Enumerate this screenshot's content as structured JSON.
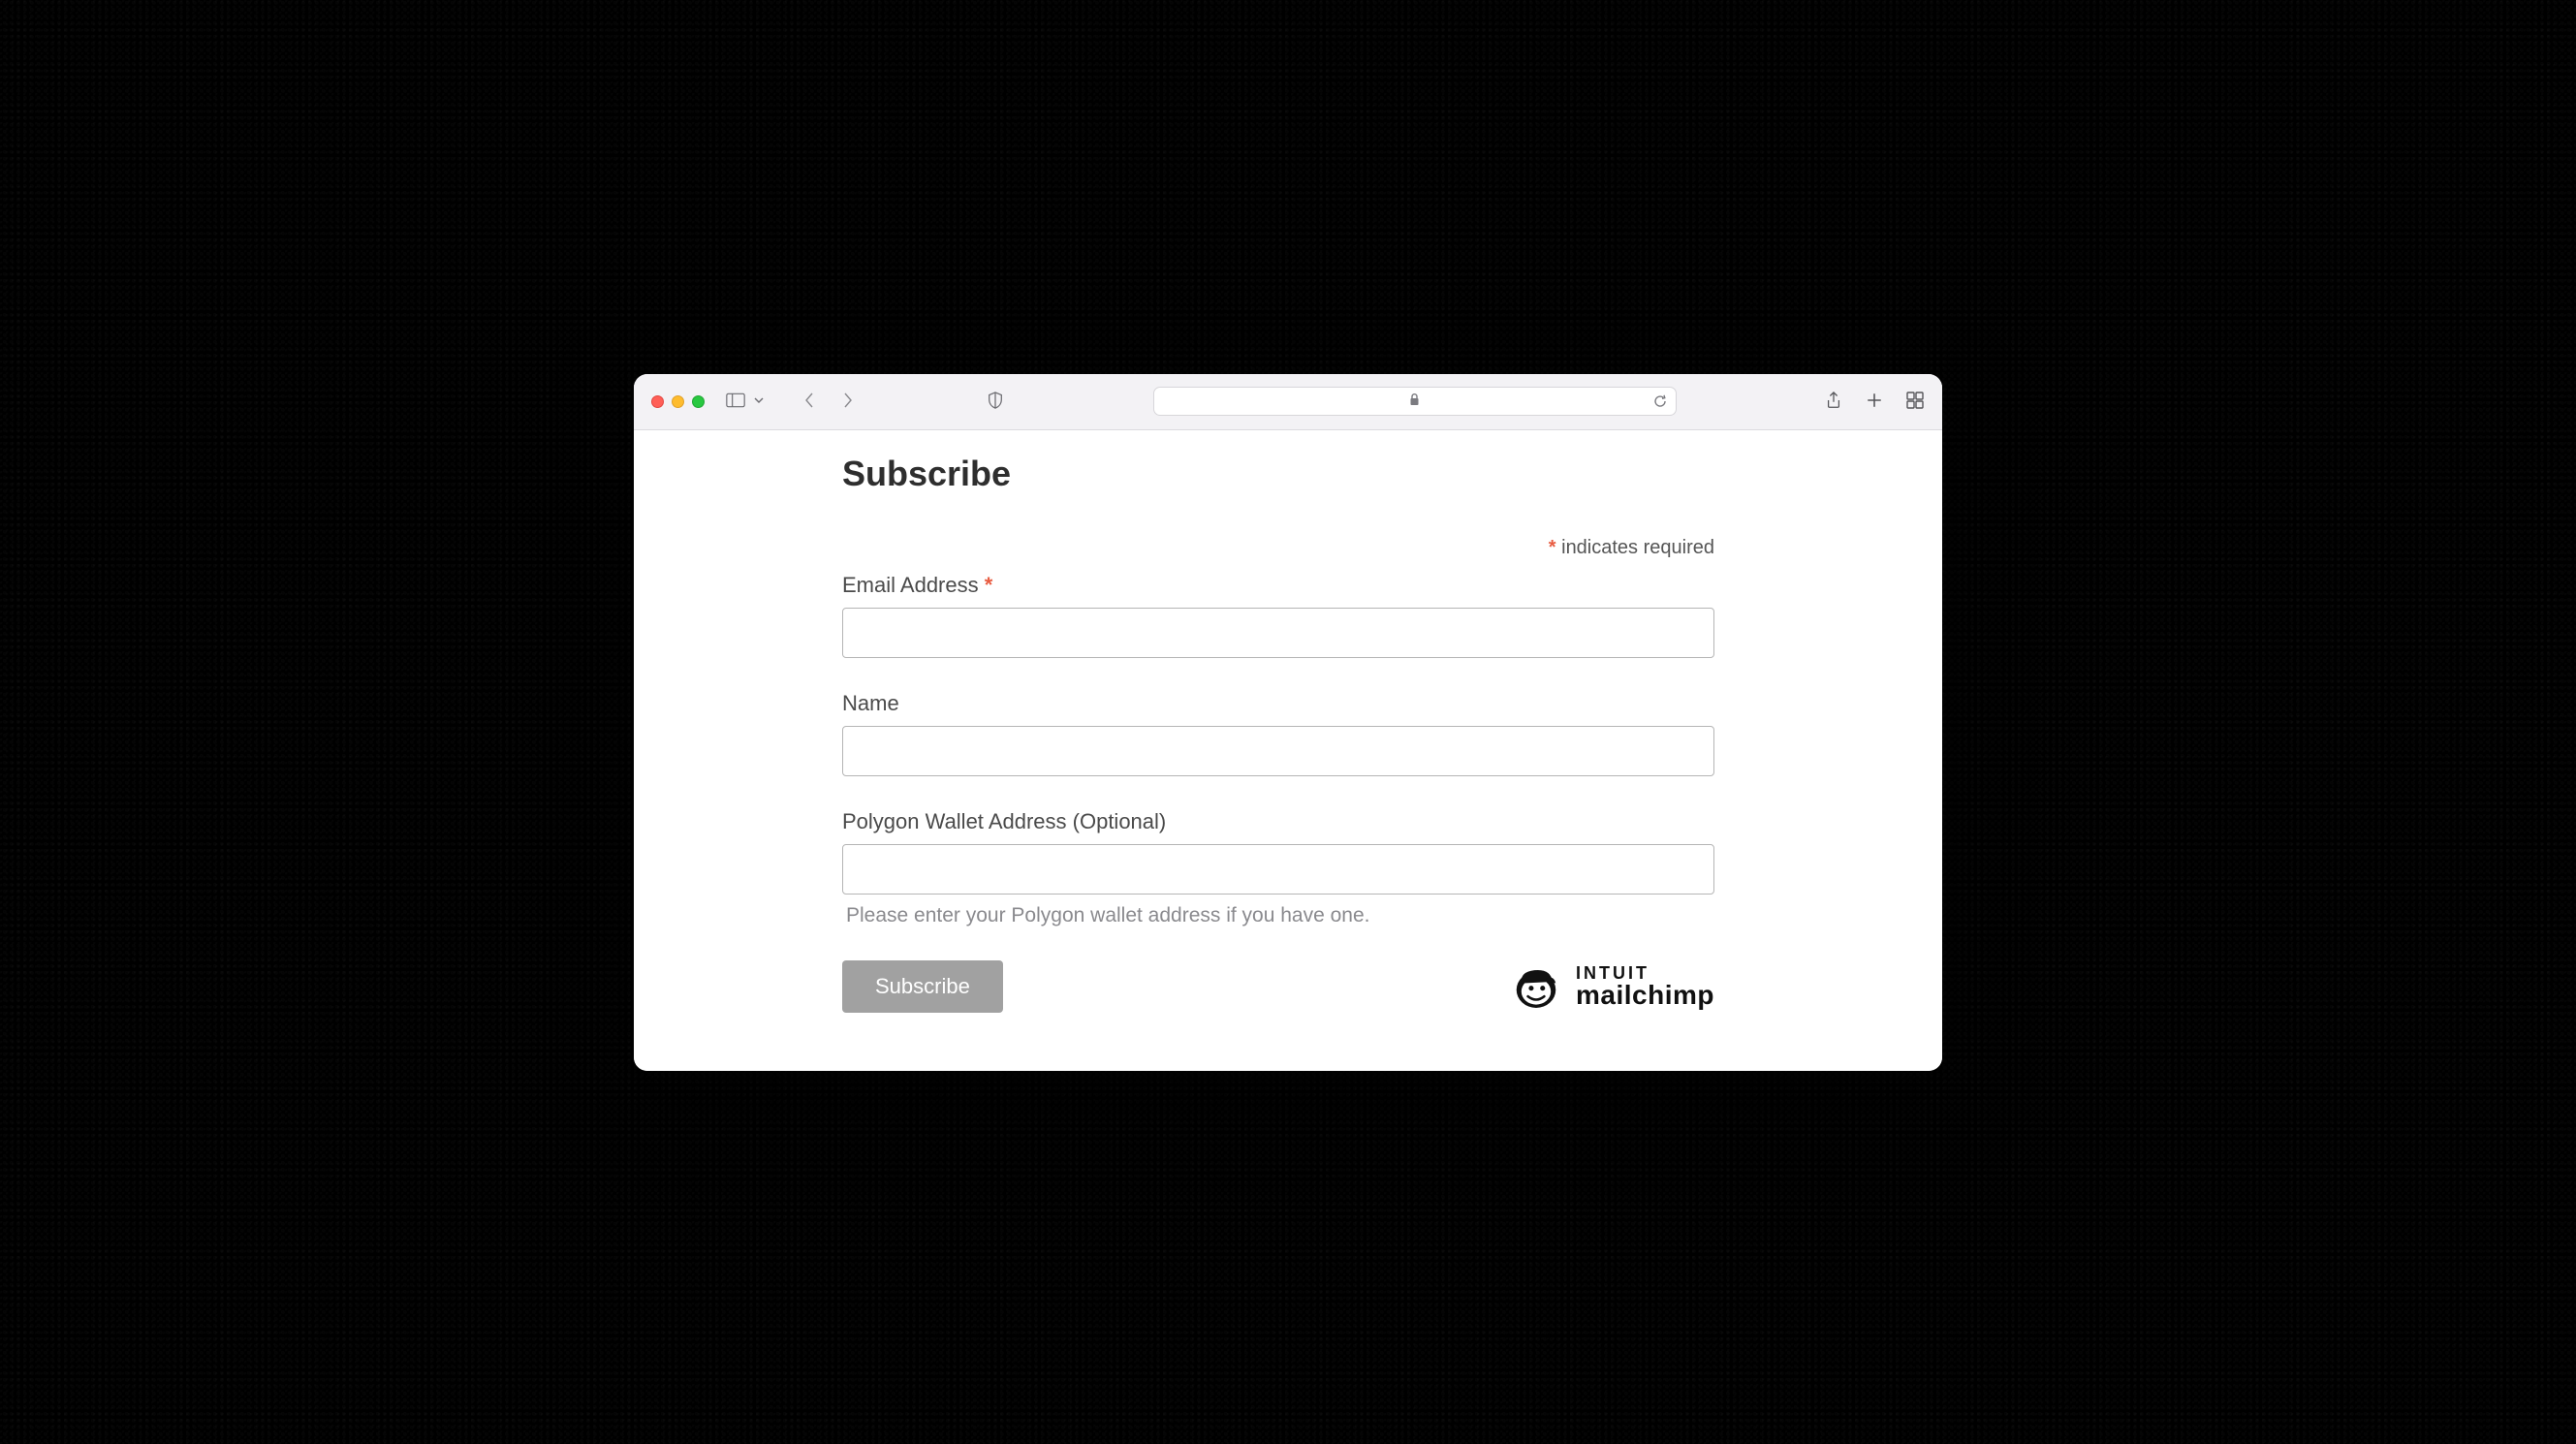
{
  "browser": {
    "address": "",
    "secure": true
  },
  "form": {
    "title": "Subscribe",
    "required_note": " indicates required",
    "asterisk": "*",
    "email": {
      "label": "Email Address ",
      "value": ""
    },
    "name": {
      "label": "Name",
      "value": ""
    },
    "wallet": {
      "label": "Polygon Wallet Address (Optional)",
      "value": "",
      "help": "Please enter your Polygon wallet address if you have one."
    },
    "submit_label": "Subscribe",
    "badge": {
      "brand_top": "INTUIT",
      "brand_bottom": "mailchimp"
    }
  }
}
